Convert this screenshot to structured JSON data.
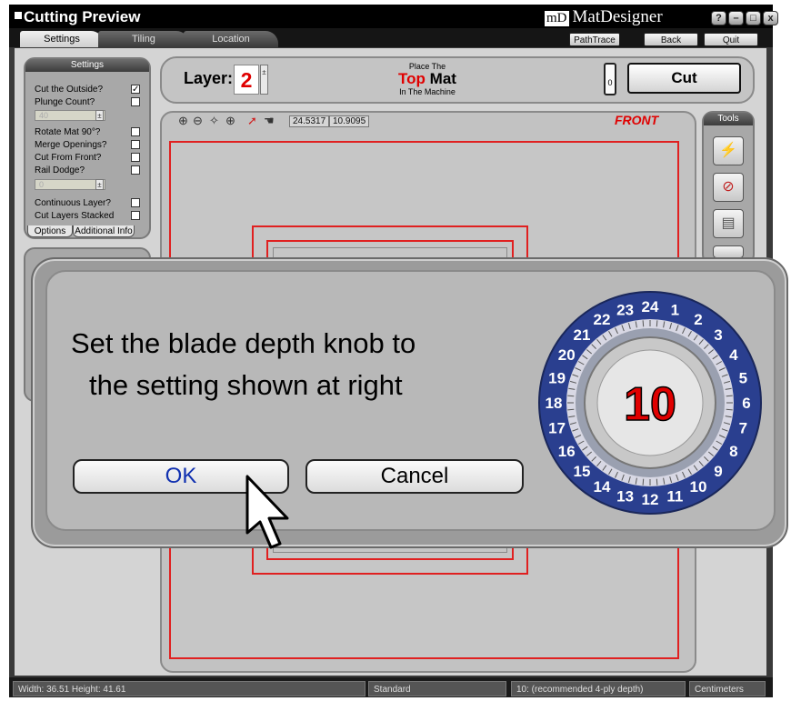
{
  "window": {
    "title": "Cutting Preview",
    "brand_logo": "mD",
    "brand_name": "MatDesigner",
    "controls": [
      "?",
      "–",
      "□",
      "x"
    ]
  },
  "tabs": [
    "Settings",
    "Tiling",
    "Location"
  ],
  "top_buttons": [
    "PathTrace",
    "Back",
    "Quit"
  ],
  "settings": {
    "header": "Settings",
    "items": [
      {
        "label": "Cut the Outside?",
        "checked": true
      },
      {
        "label": "Plunge Count?",
        "checked": false
      },
      {
        "label": "Rotate Mat 90°?",
        "checked": false
      },
      {
        "label": "Merge Openings?",
        "checked": false
      },
      {
        "label": "Cut From Front?",
        "checked": false
      },
      {
        "label": "Rail Dodge?",
        "checked": false
      },
      {
        "label": "Continuous Layer?",
        "checked": false
      },
      {
        "label": "Cut Layers Stacked",
        "checked": false
      }
    ],
    "plunge_value": "40",
    "rail_value": "0",
    "subtabs": [
      "Options",
      "Additional Info"
    ]
  },
  "layer": {
    "label": "Layer:",
    "value": "2"
  },
  "instruction": {
    "line1": "Place The",
    "emph": "Top",
    "word": "Mat",
    "line3": "In The Machine"
  },
  "cut_button": "Cut",
  "knife_icon_text": "0",
  "preview": {
    "coord_x": "24.5317",
    "coord_y": "10.9095",
    "front_label": "FRONT"
  },
  "tools_header": "Tools",
  "dialog": {
    "message_line1": "Set the blade depth knob to",
    "message_line2": "the setting shown at right",
    "ok": "OK",
    "cancel": "Cancel",
    "dial_value": "10",
    "dial_numbers": [
      "24",
      "1",
      "2",
      "3",
      "4",
      "5",
      "6",
      "7",
      "8",
      "9",
      "10",
      "11",
      "12",
      "13",
      "14",
      "15",
      "16",
      "17",
      "18",
      "19",
      "20",
      "21",
      "22",
      "23"
    ]
  },
  "status": {
    "size": "Width: 36.51  Height: 41.61",
    "mode": "Standard",
    "depth": "10: (recommended 4-ply depth)",
    "units": "Centimeters"
  },
  "colors": {
    "accent_red": "#e00000",
    "dial_blue": "#2a3f8f",
    "ok_blue": "#1030b0"
  }
}
